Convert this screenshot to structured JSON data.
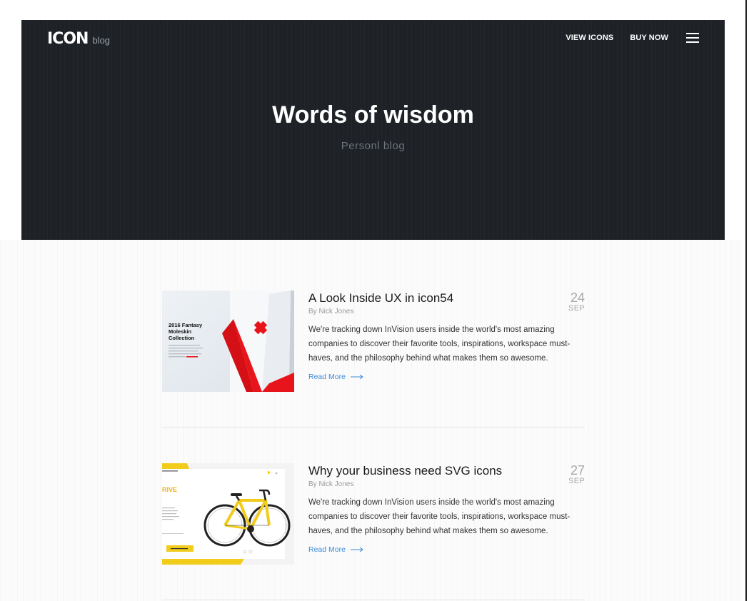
{
  "header": {
    "logo_mark": "ICON",
    "logo_word": "blog",
    "nav": [
      {
        "label": "VIEW ICONS"
      },
      {
        "label": "BUY NOW"
      }
    ],
    "menu_icon": "hamburger-menu-icon"
  },
  "hero": {
    "title": "Words of wisdom",
    "subtitle": "Personl blog"
  },
  "posts": [
    {
      "title": "A Look Inside UX in icon54",
      "author": "By Nick Jones",
      "excerpt": "We're tracking down InVision users inside the world's most amazing companies to discover their favorite tools, inspirations, workspace must-haves, and the philosophy behind what makes them so awesome.",
      "read_more": "Read More",
      "day": "24",
      "month": "SEP",
      "thumb": {
        "title": "2016 Fantasy Moleskin Collection"
      }
    },
    {
      "title": "Why your business need SVG icons",
      "author": "By Nick Jones",
      "excerpt": "We're tracking down InVision users inside the world's most amazing companies to discover their favorite tools, inspirations, workspace must-haves, and the philosophy behind what makes them so awesome.",
      "read_more": "Read More",
      "day": "27",
      "month": "SEP",
      "thumb": {
        "heading": "RIVE"
      }
    }
  ],
  "colors": {
    "hero_bg": "#1e2227",
    "accent_link": "#3d8bd8",
    "thumb_red": "#e8141b",
    "thumb_yellow": "#f2cc1b"
  }
}
